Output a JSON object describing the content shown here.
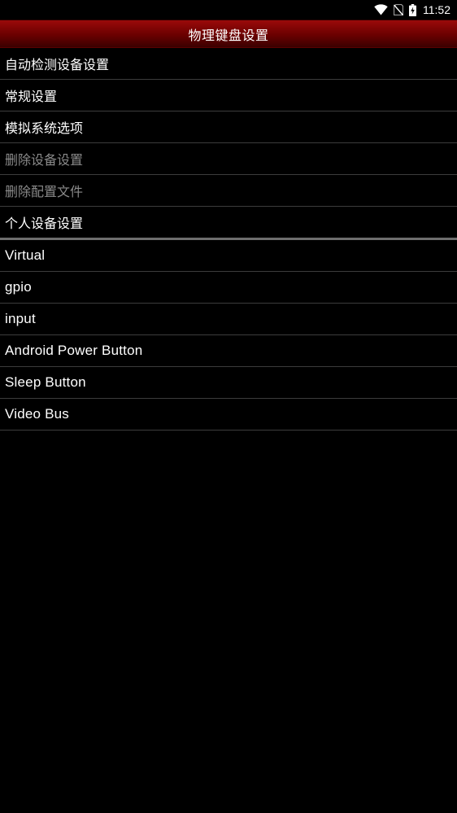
{
  "status_bar": {
    "time": "11:52",
    "icons": [
      "wifi-icon",
      "no-sim-icon",
      "battery-charging-icon"
    ]
  },
  "header": {
    "title": "物理键盘设置"
  },
  "settings_items": [
    {
      "label": "自动检测设备设置",
      "enabled": true
    },
    {
      "label": "常规设置",
      "enabled": true
    },
    {
      "label": "模拟系统选项",
      "enabled": true
    },
    {
      "label": "删除设备设置",
      "enabled": false
    },
    {
      "label": "删除配置文件",
      "enabled": false
    },
    {
      "label": "个人设备设置",
      "enabled": true
    }
  ],
  "devices": [
    {
      "label": "Virtual"
    },
    {
      "label": "gpio"
    },
    {
      "label": "input"
    },
    {
      "label": "Android Power Button"
    },
    {
      "label": "Sleep Button"
    },
    {
      "label": "Video Bus"
    }
  ],
  "colors": {
    "background": "#000000",
    "title_bar": "#7a0000",
    "divider": "#3c3c3c",
    "disabled_text": "#8a8a8a"
  }
}
